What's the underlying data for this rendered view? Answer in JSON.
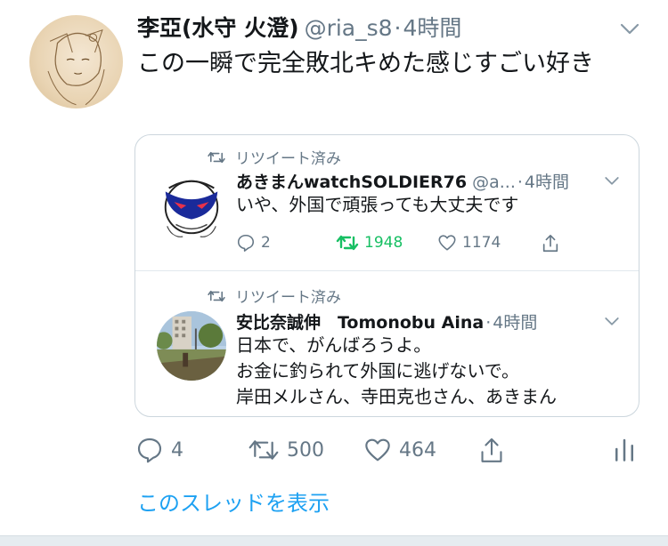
{
  "tweet": {
    "author_name": "李亞(水守 火澄)",
    "handle": "@ria_s8",
    "separator": "·",
    "time": "4時間",
    "text": "この一瞬で完全敗北キめた感じすごい好き",
    "actions": {
      "reply_count": "4",
      "retweet_count": "500",
      "like_count": "464"
    }
  },
  "quoted": [
    {
      "retweet_label": "リツイート済み",
      "author_name": "あきまんwatchSOLDIER76",
      "handle": "@a...",
      "separator": "·",
      "time": "4時間",
      "text_lines": [
        "いや、外国で頑張っても大丈夫です"
      ],
      "reply_count": "2",
      "retweet_count": "1948",
      "like_count": "1174"
    },
    {
      "retweet_label": "リツイート済み",
      "author_name": "安比奈誠伸　Tomonobu Aina",
      "separator": "·",
      "time": "4時間",
      "text_lines": [
        "日本で、がんばろうよ。",
        "お金に釣られて外国に逃げないで。",
        "岸田メルさん、寺田克也さん、あきまん"
      ]
    }
  ],
  "thread_link": "このスレッドを表示",
  "colors": {
    "accent": "#1da1f2",
    "retweet_green": "#17bf63",
    "muted": "#657786",
    "text": "#14171a",
    "border": "#ccd6dd"
  }
}
